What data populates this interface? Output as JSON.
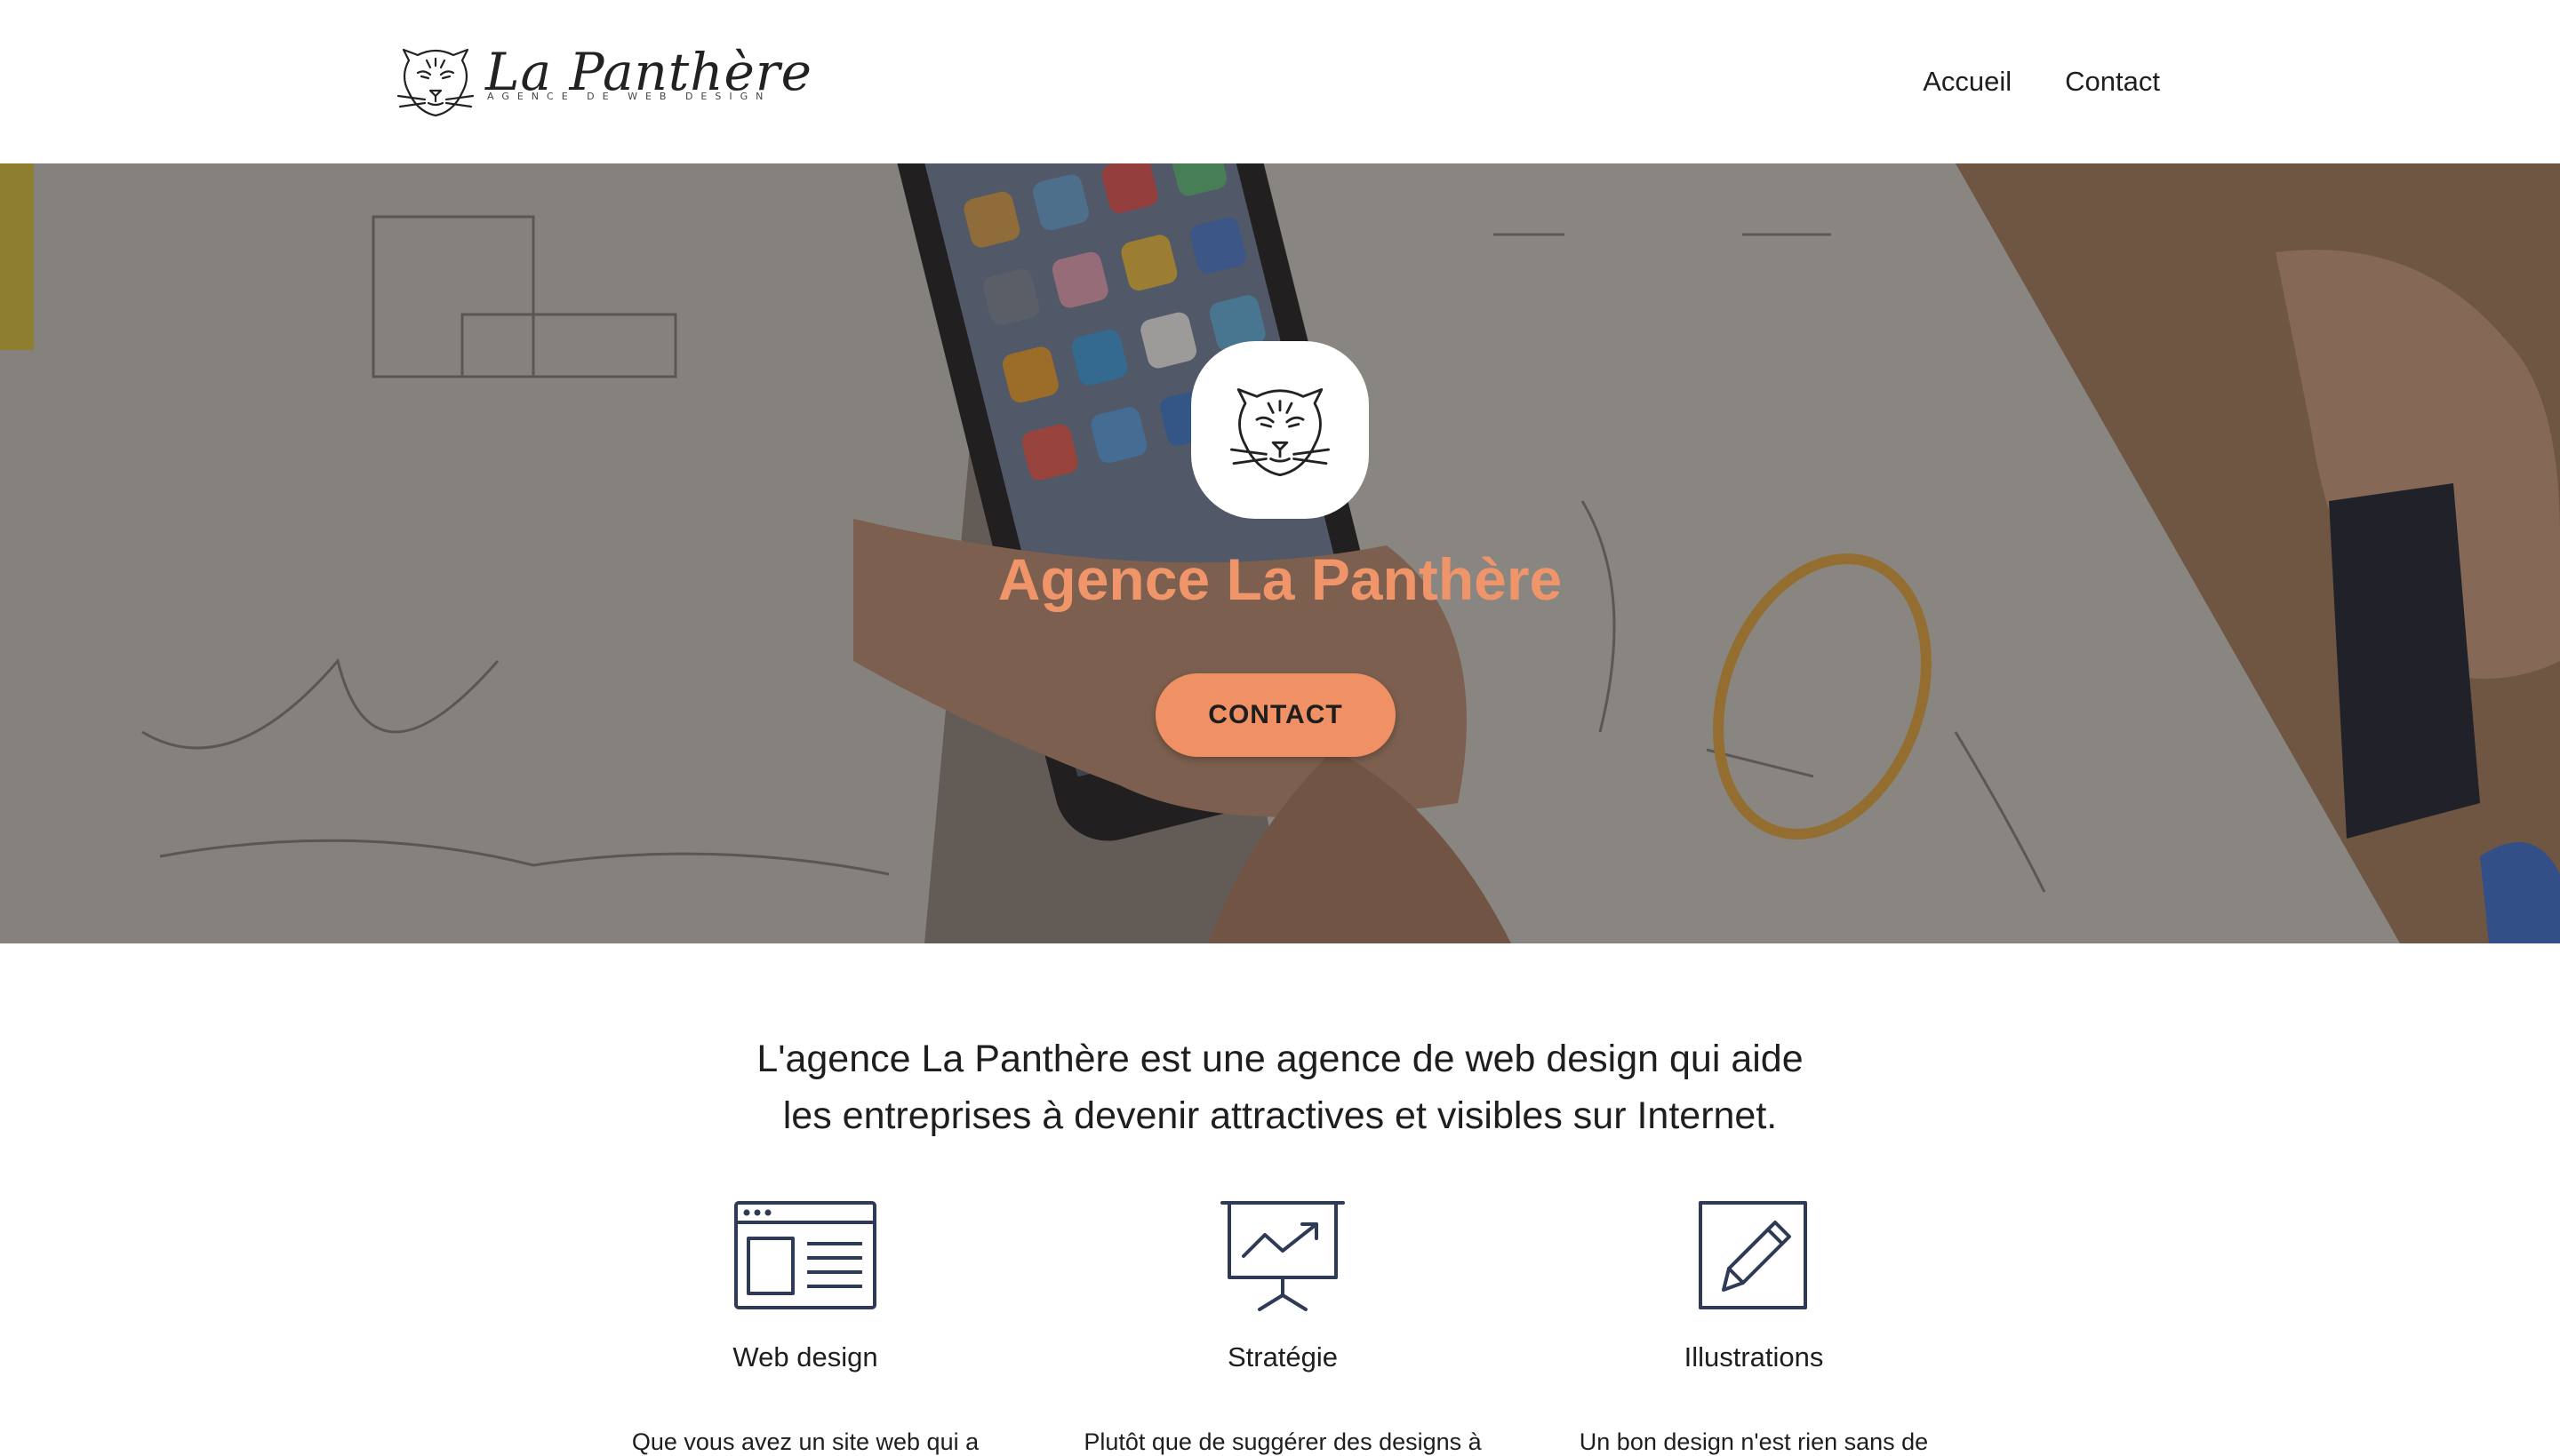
{
  "header": {
    "brand_name": "La Panthère",
    "brand_tagline": "AGENCE DE WEB DESIGN",
    "nav": [
      {
        "label": "Accueil"
      },
      {
        "label": "Contact"
      }
    ]
  },
  "hero": {
    "title": "Agence La Panthère",
    "cta_label": "CONTACT"
  },
  "intro": {
    "line1": "L'agence La Panthère est une agence de web design qui aide",
    "line2": "les entreprises à devenir attractives et visibles sur Internet."
  },
  "services": [
    {
      "icon": "browser-layout-icon",
      "title": "Web design",
      "desc": "Que vous avez un site web qui a"
    },
    {
      "icon": "presentation-chart-icon",
      "title": "Stratégie",
      "desc": "Plutôt que de suggérer des designs à"
    },
    {
      "icon": "pencil-edit-icon",
      "title": "Illustrations",
      "desc": "Un bon design n'est rien sans de"
    }
  ],
  "colors": {
    "accent": "#ef9165",
    "hero_title": "#f0956a",
    "icon_stroke": "#2f3a55",
    "text": "#1e1e1e"
  }
}
